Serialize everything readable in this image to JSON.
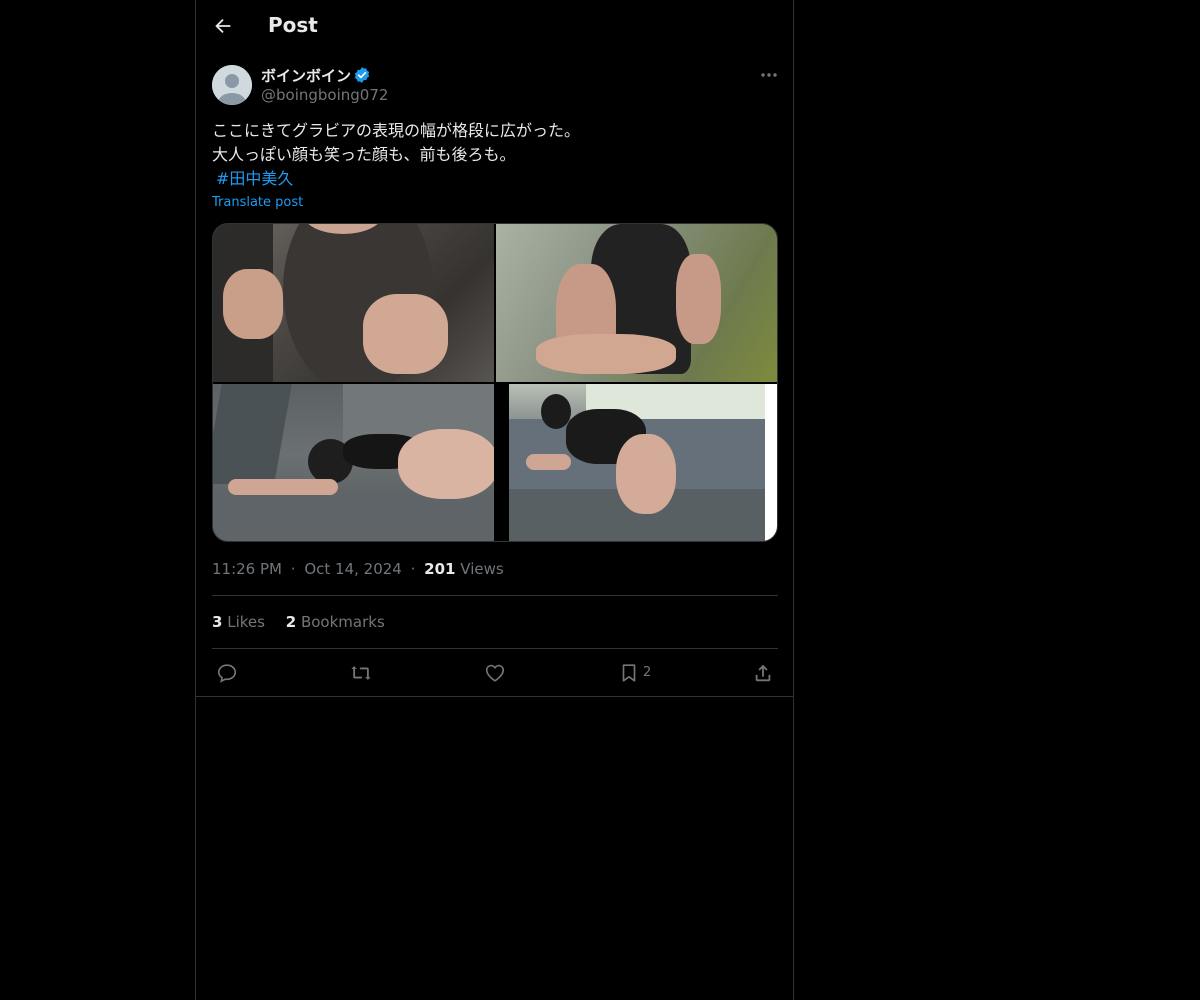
{
  "header": {
    "title": "Post",
    "back_icon": "arrow-left-icon"
  },
  "author": {
    "display_name": "ボインボイン",
    "handle": "@boingboing072",
    "verified": true,
    "verified_color": "#1d9bf0"
  },
  "post": {
    "text": "ここにきてグラビアの表現の幅が格段に広がった。\n大人っぽい顔も笑った顔も、前も後ろも。",
    "hashtag": "#田中美久",
    "translate_label": "Translate post",
    "media": [
      {
        "alt": "photo-1"
      },
      {
        "alt": "photo-2"
      },
      {
        "alt": "photo-3"
      },
      {
        "alt": "photo-4"
      }
    ],
    "time": "11:26 PM",
    "separator": "·",
    "date": "Oct 14, 2024",
    "views_count": "201",
    "views_label": "Views"
  },
  "stats": {
    "likes_count": "3",
    "likes_label": "Likes",
    "bookmarks_count": "2",
    "bookmarks_label": "Bookmarks"
  },
  "actions": {
    "bookmark_count": "2"
  },
  "colors": {
    "background": "#000000",
    "text": "#e7e9ea",
    "muted": "#71767b",
    "accent": "#1d9bf0",
    "border": "#2f3336"
  }
}
